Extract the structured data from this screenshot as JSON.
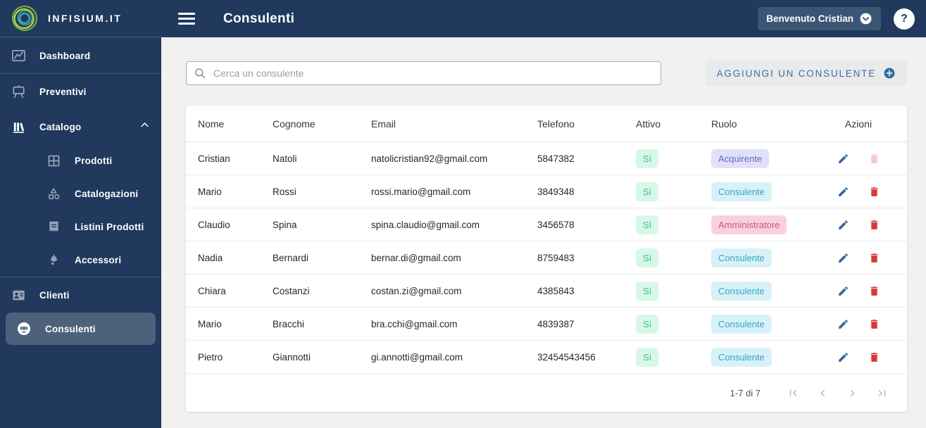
{
  "brand": {
    "name": "INFISIUM.IT"
  },
  "header": {
    "title": "Consulenti",
    "user_button": "Benvenuto Cristian",
    "help_label": "?"
  },
  "sidebar": {
    "items": [
      {
        "label": "Dashboard"
      },
      {
        "label": "Preventivi"
      },
      {
        "label": "Catalogo",
        "expanded": true
      },
      {
        "label": "Prodotti"
      },
      {
        "label": "Catalogazioni"
      },
      {
        "label": "Listini Prodotti"
      },
      {
        "label": "Accessori"
      },
      {
        "label": "Clienti"
      },
      {
        "label": "Consulenti",
        "active": true
      }
    ]
  },
  "search": {
    "placeholder": "Cerca un consulente",
    "value": ""
  },
  "add_button": {
    "label": "AGGIUNGI UN CONSULENTE"
  },
  "table": {
    "columns": [
      "Nome",
      "Cognome",
      "Email",
      "Telefono",
      "Attivo",
      "Ruolo",
      "Azioni"
    ],
    "rows": [
      {
        "nome": "Cristian",
        "cognome": "Natoli",
        "email": "natolicristian92@gmail.com",
        "telefono": "5847382",
        "attivo": "Sì",
        "ruolo": "Acquirente",
        "ruolo_style": "purple",
        "delete_disabled": true
      },
      {
        "nome": "Mario",
        "cognome": "Rossi",
        "email": "rossi.mario@gmail.com",
        "telefono": "3849348",
        "attivo": "Sì",
        "ruolo": "Consulente",
        "ruolo_style": "cyan",
        "delete_disabled": false
      },
      {
        "nome": "Claudio",
        "cognome": "Spina",
        "email": "spina.claudio@gmail.com",
        "telefono": "3456578",
        "attivo": "Sì",
        "ruolo": "Amministratore",
        "ruolo_style": "pink",
        "delete_disabled": false
      },
      {
        "nome": "Nadia",
        "cognome": "Bernardi",
        "email": "bernar.di@gmail.com",
        "telefono": "8759483",
        "attivo": "Sì",
        "ruolo": "Consulente",
        "ruolo_style": "cyan",
        "delete_disabled": false
      },
      {
        "nome": "Chiara",
        "cognome": "Costanzi",
        "email": "costan.zi@gmail.com",
        "telefono": "4385843",
        "attivo": "Sì",
        "ruolo": "Consulente",
        "ruolo_style": "cyan",
        "delete_disabled": false
      },
      {
        "nome": "Mario",
        "cognome": "Bracchi",
        "email": "bra.cchi@gmail.com",
        "telefono": "4839387",
        "attivo": "Sì",
        "ruolo": "Consulente",
        "ruolo_style": "cyan",
        "delete_disabled": false
      },
      {
        "nome": "Pietro",
        "cognome": "Giannotti",
        "email": "gi.annotti@gmail.com",
        "telefono": "32454543456",
        "attivo": "Sì",
        "ruolo": "Consulente",
        "ruolo_style": "cyan",
        "delete_disabled": false
      }
    ]
  },
  "pagination": {
    "range_label": "1-7 di 7"
  },
  "colors": {
    "sidebar_bg": "#20395c",
    "topbar_bg": "#20395c",
    "active_item_bg": "#4e617c",
    "content_bg": "#f1f1ef",
    "accent_blue": "#3d6f9e",
    "edit_icon": "#39689b",
    "delete_icon": "#d63b3b",
    "delete_icon_disabled": "#f5c8c8",
    "badge_green_bg": "#d7f7e8",
    "badge_green_text": "#40bf8a",
    "badge_purple_bg": "#e2e0f9",
    "badge_purple_text": "#5f6ac4",
    "badge_cyan_bg": "#d8f1f8",
    "badge_cyan_text": "#2fa8c5",
    "badge_pink_bg": "#f7d2de",
    "badge_pink_text": "#d94f77"
  }
}
